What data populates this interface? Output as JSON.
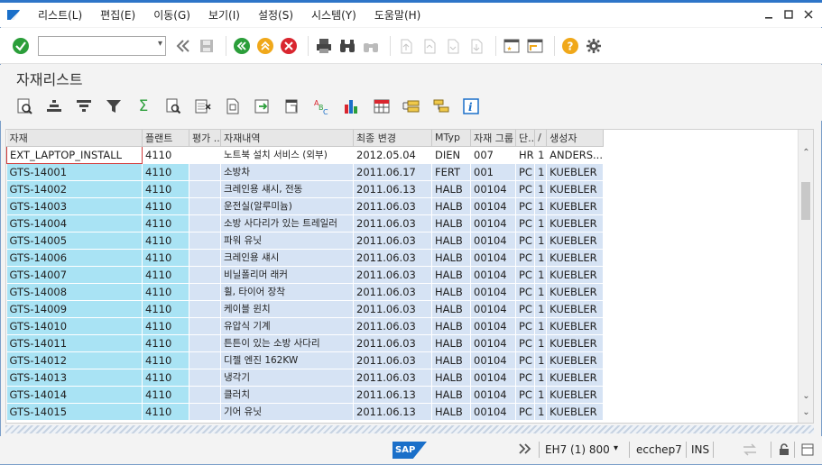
{
  "menu": {
    "items": [
      "리스트(L)",
      "편집(E)",
      "이동(G)",
      "보기(I)",
      "설정(S)",
      "시스템(Y)",
      "도움말(H)"
    ]
  },
  "toolbar": {
    "command_value": ""
  },
  "page": {
    "title": "자재리스트"
  },
  "table": {
    "columns": [
      "자재",
      "플랜트",
      "평가 ..",
      "자재내역",
      "최종 변경",
      "MTyp",
      "자재 그룹",
      "단..",
      "/",
      "생성자"
    ],
    "rows": [
      [
        "EXT_LAPTOP_INSTALL",
        "4110",
        "",
        "노트북 설치 서비스 (외부)",
        "2012.05.04",
        "DIEN",
        "007",
        "HR",
        "1",
        "ANDERS..."
      ],
      [
        "GTS-14001",
        "4110",
        "",
        "소방차",
        "2011.06.17",
        "FERT",
        "001",
        "PC",
        "1",
        "KUEBLER"
      ],
      [
        "GTS-14002",
        "4110",
        "",
        "크레인용 섀시, 전동",
        "2011.06.13",
        "HALB",
        "00104",
        "PC",
        "1",
        "KUEBLER"
      ],
      [
        "GTS-14003",
        "4110",
        "",
        "운전실(알루미늄)",
        "2011.06.03",
        "HALB",
        "00104",
        "PC",
        "1",
        "KUEBLER"
      ],
      [
        "GTS-14004",
        "4110",
        "",
        "소방 사다리가 있는 트레일러",
        "2011.06.03",
        "HALB",
        "00104",
        "PC",
        "1",
        "KUEBLER"
      ],
      [
        "GTS-14005",
        "4110",
        "",
        "파워 유닛",
        "2011.06.03",
        "HALB",
        "00104",
        "PC",
        "1",
        "KUEBLER"
      ],
      [
        "GTS-14006",
        "4110",
        "",
        "크레인용 섀시",
        "2011.06.03",
        "HALB",
        "00104",
        "PC",
        "1",
        "KUEBLER"
      ],
      [
        "GTS-14007",
        "4110",
        "",
        "비닐폴리머 래커",
        "2011.06.03",
        "HALB",
        "00104",
        "PC",
        "1",
        "KUEBLER"
      ],
      [
        "GTS-14008",
        "4110",
        "",
        "휠, 타이어 장착",
        "2011.06.03",
        "HALB",
        "00104",
        "PC",
        "1",
        "KUEBLER"
      ],
      [
        "GTS-14009",
        "4110",
        "",
        "케이블 윈치",
        "2011.06.03",
        "HALB",
        "00104",
        "PC",
        "1",
        "KUEBLER"
      ],
      [
        "GTS-14010",
        "4110",
        "",
        "유압식 기계",
        "2011.06.03",
        "HALB",
        "00104",
        "PC",
        "1",
        "KUEBLER"
      ],
      [
        "GTS-14011",
        "4110",
        "",
        "튼튼이 있는 소방 사다리",
        "2011.06.03",
        "HALB",
        "00104",
        "PC",
        "1",
        "KUEBLER"
      ],
      [
        "GTS-14012",
        "4110",
        "",
        "디젤 엔진 162KW",
        "2011.06.03",
        "HALB",
        "00104",
        "PC",
        "1",
        "KUEBLER"
      ],
      [
        "GTS-14013",
        "4110",
        "",
        "냉각기",
        "2011.06.03",
        "HALB",
        "00104",
        "PC",
        "1",
        "KUEBLER"
      ],
      [
        "GTS-14014",
        "4110",
        "",
        "클러치",
        "2011.06.13",
        "HALB",
        "00104",
        "PC",
        "1",
        "KUEBLER"
      ],
      [
        "GTS-14015",
        "4110",
        "",
        "기어 유닛",
        "2011.06.13",
        "HALB",
        "00104",
        "PC",
        "1",
        "KUEBLER"
      ]
    ]
  },
  "status": {
    "logo": "SAP",
    "system": "EH7 (1) 800",
    "server": "ecchep7",
    "mode": "INS"
  },
  "colors": {
    "key_column_bg": "#a9e3f4",
    "row_bg": "#d6e3f4",
    "accent": "#2e75c8"
  }
}
